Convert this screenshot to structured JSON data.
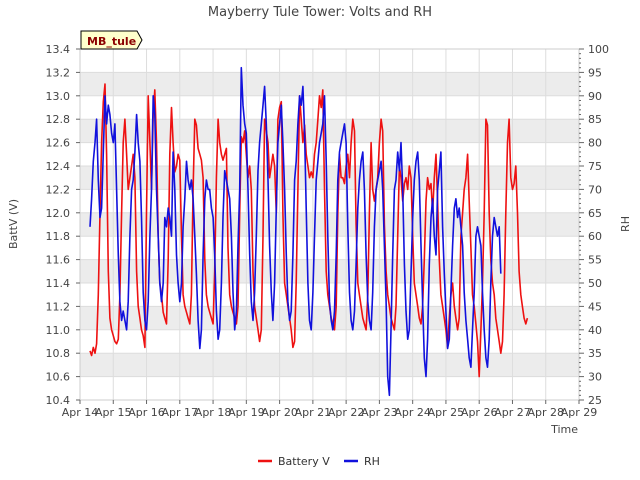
{
  "chart_data": {
    "type": "line",
    "title": "Mayberry Tule Tower: Volts and RH",
    "site_label": "MB_tule",
    "xlabel": "Time",
    "ylabel_left": "BattV (V)",
    "ylabel_right": "RH",
    "x_ticks": [
      "Apr 14",
      "Apr 15",
      "Apr 16",
      "Apr 17",
      "Apr 18",
      "Apr 19",
      "Apr 20",
      "Apr 21",
      "Apr 22",
      "Apr 23",
      "Apr 24",
      "Apr 25",
      "Apr 26",
      "Apr 27",
      "Apr 28",
      "Apr 29"
    ],
    "x_range": [
      "Apr 14",
      "Apr 29"
    ],
    "ylim_left": [
      10.4,
      13.4
    ],
    "ylim_right": [
      25,
      100
    ],
    "y_ticks_left": [
      "10.4",
      "10.6",
      "10.8",
      "11.0",
      "11.2",
      "11.4",
      "11.6",
      "11.8",
      "12.0",
      "12.2",
      "12.4",
      "12.6",
      "12.8",
      "13.0",
      "13.2",
      "13.4"
    ],
    "y_ticks_right": [
      "25",
      "30",
      "35",
      "40",
      "45",
      "50",
      "55",
      "60",
      "65",
      "70",
      "75",
      "80",
      "85",
      "90",
      "95",
      "100"
    ],
    "grid": true,
    "legend_position": "bottom-center",
    "colors": {
      "battery": "#ee1111",
      "rh": "#1111dd",
      "band": "#ececec",
      "label_bg": "#ffffcc",
      "label_text": "#8b0000"
    },
    "series": [
      {
        "name": "Battery V",
        "axis": "left",
        "x_days": [
          14.3,
          14.35,
          14.4,
          14.45,
          14.5,
          14.55,
          14.6,
          14.65,
          14.7,
          14.75,
          14.8,
          14.85,
          14.9,
          14.95,
          15.0,
          15.05,
          15.1,
          15.15,
          15.2,
          15.25,
          15.3,
          15.35,
          15.4,
          15.45,
          15.5,
          15.55,
          15.6,
          15.65,
          15.7,
          15.75,
          15.8,
          15.85,
          15.9,
          15.95,
          16.0,
          16.05,
          16.1,
          16.15,
          16.2,
          16.25,
          16.3,
          16.35,
          16.4,
          16.45,
          16.5,
          16.55,
          16.6,
          16.65,
          16.7,
          16.75,
          16.8,
          16.85,
          16.9,
          16.95,
          17.0,
          17.05,
          17.1,
          17.15,
          17.2,
          17.25,
          17.3,
          17.35,
          17.4,
          17.45,
          17.5,
          17.55,
          17.6,
          17.65,
          17.7,
          17.75,
          17.8,
          17.85,
          17.9,
          17.95,
          18.0,
          18.05,
          18.1,
          18.15,
          18.2,
          18.25,
          18.3,
          18.35,
          18.4,
          18.45,
          18.5,
          18.55,
          18.6,
          18.65,
          18.7,
          18.75,
          18.8,
          18.85,
          18.9,
          18.95,
          19.0,
          19.05,
          19.1,
          19.15,
          19.2,
          19.25,
          19.3,
          19.35,
          19.4,
          19.45,
          19.5,
          19.55,
          19.6,
          19.65,
          19.7,
          19.75,
          19.8,
          19.85,
          19.9,
          19.95,
          20.0,
          20.05,
          20.1,
          20.15,
          20.2,
          20.25,
          20.3,
          20.35,
          20.4,
          20.45,
          20.5,
          20.55,
          20.6,
          20.65,
          20.7,
          20.75,
          20.8,
          20.85,
          20.9,
          20.95,
          21.0,
          21.05,
          21.1,
          21.15,
          21.2,
          21.25,
          21.3,
          21.35,
          21.4,
          21.45,
          21.5,
          21.55,
          21.6,
          21.65,
          21.7,
          21.75,
          21.8,
          21.85,
          21.9,
          21.95,
          22.0,
          22.05,
          22.1,
          22.15,
          22.2,
          22.25,
          22.3,
          22.35,
          22.4,
          22.45,
          22.5,
          22.55,
          22.6,
          22.65,
          22.7,
          22.75,
          22.8,
          22.85,
          22.9,
          22.95,
          23.0,
          23.05,
          23.1,
          23.15,
          23.2,
          23.25,
          23.3,
          23.35,
          23.4,
          23.45,
          23.5,
          23.55,
          23.6,
          23.65,
          23.7,
          23.75,
          23.8,
          23.85,
          23.9,
          23.95,
          24.0,
          24.05,
          24.1,
          24.15,
          24.2,
          24.25,
          24.3,
          24.35,
          24.4,
          24.45,
          24.5,
          24.55,
          24.6,
          24.65,
          24.7,
          24.75,
          24.8,
          24.85,
          24.9,
          24.95,
          25.0,
          25.05,
          25.1,
          25.15,
          25.2,
          25.25,
          25.3,
          25.35,
          25.4,
          25.45,
          25.5,
          25.55,
          25.6,
          25.65,
          25.7,
          25.75,
          25.8,
          25.85,
          25.9,
          25.95,
          26.0,
          26.05,
          26.1,
          26.15,
          26.2,
          26.25,
          26.3,
          26.35,
          26.4,
          26.45,
          26.5,
          26.55,
          26.6,
          26.65,
          26.7,
          26.75,
          26.8,
          26.85,
          26.9,
          26.95,
          27.0,
          27.05,
          27.1,
          27.15,
          27.2,
          27.25,
          27.3,
          27.35,
          27.4,
          27.45,
          27.5,
          27.55,
          27.6,
          27.65,
          27.7,
          27.75,
          27.8,
          27.85,
          27.9,
          27.95,
          28.0,
          28.05,
          28.1,
          28.15,
          28.2,
          28.25,
          28.3,
          28.35,
          28.4
        ],
        "values": [
          10.82,
          10.78,
          10.85,
          10.8,
          10.88,
          11.3,
          12.0,
          12.6,
          12.95,
          13.1,
          12.5,
          11.5,
          11.1,
          11.0,
          10.95,
          10.9,
          10.88,
          10.92,
          11.3,
          12.0,
          12.6,
          12.8,
          12.5,
          12.2,
          12.3,
          12.4,
          12.5,
          12.3,
          11.5,
          11.2,
          11.1,
          11.0,
          10.95,
          10.85,
          12.0,
          13.0,
          12.6,
          12.2,
          12.85,
          13.05,
          12.6,
          11.8,
          11.4,
          11.3,
          11.15,
          11.1,
          11.05,
          11.6,
          12.5,
          12.9,
          12.6,
          12.35,
          12.4,
          12.5,
          12.45,
          11.8,
          11.3,
          11.2,
          11.15,
          11.1,
          11.05,
          11.3,
          12.2,
          12.8,
          12.75,
          12.55,
          12.5,
          12.45,
          12.3,
          11.6,
          11.3,
          11.2,
          11.15,
          11.1,
          11.05,
          11.5,
          12.3,
          12.8,
          12.6,
          12.5,
          12.45,
          12.5,
          12.55,
          11.7,
          11.3,
          11.2,
          11.15,
          11.1,
          11.05,
          11.2,
          12.0,
          12.65,
          12.6,
          12.7,
          12.5,
          12.3,
          12.4,
          12.2,
          11.5,
          11.2,
          11.1,
          11.0,
          10.9,
          11.0,
          11.8,
          12.8,
          12.7,
          12.6,
          12.3,
          12.4,
          12.5,
          12.4,
          12.0,
          12.8,
          12.9,
          12.95,
          12.0,
          11.4,
          11.3,
          11.2,
          11.1,
          11.0,
          10.85,
          10.9,
          11.4,
          12.2,
          13.0,
          12.8,
          12.6,
          12.75,
          12.5,
          12.4,
          12.3,
          12.35,
          12.3,
          12.5,
          12.6,
          12.8,
          13.0,
          12.9,
          13.05,
          12.2,
          11.5,
          11.3,
          11.2,
          11.1,
          11.05,
          11.0,
          11.2,
          12.0,
          12.5,
          12.3,
          12.3,
          12.25,
          12.4,
          12.5,
          12.3,
          12.6,
          12.8,
          12.7,
          11.9,
          11.4,
          11.3,
          11.2,
          11.1,
          11.05,
          11.0,
          11.3,
          12.0,
          12.6,
          12.2,
          12.1,
          12.2,
          12.3,
          12.6,
          12.8,
          12.7,
          11.9,
          11.5,
          11.3,
          11.2,
          11.1,
          11.05,
          11.0,
          11.2,
          11.8,
          12.4,
          12.3,
          12.1,
          12.25,
          12.3,
          12.2,
          12.4,
          12.3,
          11.8,
          11.4,
          11.3,
          11.2,
          11.1,
          11.05,
          11.2,
          11.6,
          12.1,
          12.3,
          12.2,
          12.25,
          12.0,
          12.3,
          12.5,
          12.1,
          11.6,
          11.3,
          11.2,
          11.1,
          11.0,
          10.85,
          11.1,
          11.3,
          11.4,
          11.2,
          11.1,
          11.0,
          11.1,
          11.8,
          12.0,
          12.2,
          12.3,
          12.5,
          12.1,
          11.7,
          11.3,
          11.2,
          11.05,
          10.9,
          10.6,
          11.0,
          11.4,
          12.0,
          12.8,
          12.75,
          12.0,
          11.6,
          11.4,
          11.3,
          11.1,
          11.0,
          10.9,
          10.8,
          10.9,
          11.3,
          12.0,
          12.6,
          12.8,
          12.3,
          12.2,
          12.25,
          12.4,
          12.0,
          11.5,
          11.3,
          11.2,
          11.1,
          11.05,
          11.1
        ]
      },
      {
        "name": "RH",
        "axis": "right",
        "x_days": [
          14.3,
          14.35,
          14.4,
          14.45,
          14.5,
          14.55,
          14.6,
          14.65,
          14.7,
          14.75,
          14.8,
          14.85,
          14.9,
          14.95,
          15.0,
          15.05,
          15.1,
          15.15,
          15.2,
          15.25,
          15.3,
          15.35,
          15.4,
          15.45,
          15.5,
          15.55,
          15.6,
          15.65,
          15.7,
          15.75,
          15.8,
          15.85,
          15.9,
          15.95,
          16.0,
          16.05,
          16.1,
          16.15,
          16.2,
          16.25,
          16.3,
          16.35,
          16.4,
          16.45,
          16.5,
          16.55,
          16.6,
          16.65,
          16.7,
          16.75,
          16.8,
          16.85,
          16.9,
          16.95,
          17.0,
          17.05,
          17.1,
          17.15,
          17.2,
          17.25,
          17.3,
          17.35,
          17.4,
          17.45,
          17.5,
          17.55,
          17.6,
          17.65,
          17.7,
          17.75,
          17.8,
          17.85,
          17.9,
          17.95,
          18.0,
          18.05,
          18.1,
          18.15,
          18.2,
          18.25,
          18.3,
          18.35,
          18.4,
          18.45,
          18.5,
          18.55,
          18.6,
          18.65,
          18.7,
          18.75,
          18.8,
          18.85,
          18.9,
          18.95,
          19.0,
          19.05,
          19.1,
          19.15,
          19.2,
          19.25,
          19.3,
          19.35,
          19.4,
          19.45,
          19.5,
          19.55,
          19.6,
          19.65,
          19.7,
          19.75,
          19.8,
          19.85,
          19.9,
          19.95,
          20.0,
          20.05,
          20.1,
          20.15,
          20.2,
          20.25,
          20.3,
          20.35,
          20.4,
          20.45,
          20.5,
          20.55,
          20.6,
          20.65,
          20.7,
          20.75,
          20.8,
          20.85,
          20.9,
          20.95,
          21.0,
          21.05,
          21.1,
          21.15,
          21.2,
          21.25,
          21.3,
          21.35,
          21.4,
          21.45,
          21.5,
          21.55,
          21.6,
          21.65,
          21.7,
          21.75,
          21.8,
          21.85,
          21.9,
          21.95,
          22.0,
          22.05,
          22.1,
          22.15,
          22.2,
          22.25,
          22.3,
          22.35,
          22.4,
          22.45,
          22.5,
          22.55,
          22.6,
          22.65,
          22.7,
          22.75,
          22.8,
          22.85,
          22.9,
          22.95,
          23.0,
          23.05,
          23.1,
          23.15,
          23.2,
          23.25,
          23.3,
          23.35,
          23.4,
          23.45,
          23.5,
          23.55,
          23.6,
          23.65,
          23.7,
          23.75,
          23.8,
          23.85,
          23.9,
          23.95,
          24.0,
          24.05,
          24.1,
          24.15,
          24.2,
          24.25,
          24.3,
          24.35,
          24.4,
          24.45,
          24.5,
          24.55,
          24.6,
          24.65,
          24.7,
          24.75,
          24.8,
          24.85,
          24.9,
          24.95,
          25.0,
          25.05,
          25.1,
          25.15,
          25.2,
          25.25,
          25.3,
          25.35,
          25.4,
          25.45,
          25.5,
          25.55,
          25.6,
          25.65,
          25.7,
          25.75,
          25.8,
          25.85,
          25.9,
          25.95,
          26.0,
          26.05,
          26.1,
          26.15,
          26.2,
          26.25,
          26.3,
          26.35,
          26.4,
          26.45,
          26.5,
          26.55,
          26.6,
          26.65,
          26.7,
          26.75,
          26.8,
          26.85,
          26.9,
          26.95,
          27.0,
          27.05,
          27.1,
          27.15,
          27.2,
          27.25,
          27.3,
          27.35,
          27.4,
          27.45,
          27.5,
          27.55,
          27.6,
          27.65,
          27.7,
          27.75,
          27.8,
          27.85,
          27.9,
          27.95,
          28.0,
          28.05,
          28.1,
          28.15,
          28.2,
          28.25,
          28.3,
          28.35,
          28.4
        ],
        "values": [
          62,
          68,
          76,
          80,
          85,
          72,
          64,
          66,
          78,
          90,
          84,
          88,
          86,
          82,
          80,
          84,
          70,
          56,
          46,
          42,
          44,
          42,
          40,
          46,
          60,
          70,
          72,
          78,
          86,
          80,
          76,
          64,
          48,
          42,
          40,
          46,
          60,
          70,
          90,
          86,
          70,
          60,
          50,
          46,
          50,
          64,
          62,
          66,
          64,
          60,
          78,
          70,
          56,
          50,
          46,
          50,
          62,
          68,
          76,
          72,
          70,
          72,
          68,
          60,
          52,
          42,
          36,
          40,
          56,
          68,
          72,
          70,
          70,
          66,
          64,
          56,
          44,
          38,
          40,
          50,
          64,
          74,
          72,
          70,
          68,
          60,
          48,
          40,
          44,
          58,
          70,
          96,
          88,
          84,
          82,
          70,
          56,
          46,
          42,
          48,
          60,
          74,
          80,
          84,
          88,
          92,
          84,
          72,
          58,
          48,
          42,
          50,
          66,
          80,
          84,
          88,
          80,
          70,
          56,
          46,
          42,
          44,
          56,
          72,
          76,
          84,
          90,
          88,
          92,
          82,
          66,
          50,
          42,
          40,
          48,
          60,
          72,
          76,
          80,
          82,
          84,
          90,
          76,
          60,
          46,
          42,
          40,
          44,
          56,
          72,
          78,
          80,
          82,
          84,
          80,
          62,
          48,
          42,
          40,
          44,
          54,
          66,
          72,
          76,
          78,
          70,
          56,
          46,
          42,
          40,
          48,
          62,
          70,
          72,
          74,
          76,
          70,
          58,
          46,
          30,
          26,
          40,
          56,
          70,
          72,
          78,
          74,
          80,
          70,
          54,
          44,
          38,
          40,
          52,
          64,
          72,
          76,
          78,
          72,
          58,
          46,
          34,
          30,
          38,
          54,
          64,
          68,
          60,
          56,
          70,
          74,
          78,
          62,
          52,
          44,
          36,
          38,
          48,
          58,
          66,
          68,
          64,
          66,
          62,
          58,
          48,
          42,
          38,
          34,
          32,
          40,
          48,
          60,
          62,
          60,
          58,
          48,
          40,
          34,
          32,
          38,
          50,
          60,
          64,
          62,
          60,
          62,
          52
        ]
      }
    ]
  },
  "legend": {
    "battery_label": "Battery V",
    "rh_label": "RH"
  }
}
